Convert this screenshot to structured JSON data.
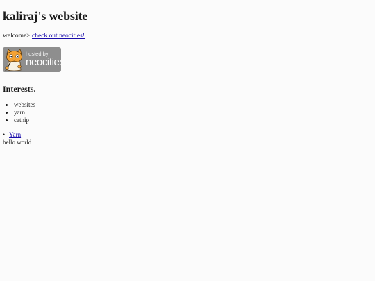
{
  "page": {
    "title": "kaliraj's website",
    "welcome_text": "welcome> ",
    "welcome_link": "check out neocities!"
  },
  "badge": {
    "hosted_by": "hosted by",
    "brand": "neocities",
    "mascot_icon": "neocities-cat-icon",
    "background_color": "#8e8e8e"
  },
  "interests": {
    "heading": "Interests.",
    "items": [
      "websites",
      "yarn",
      "catnip"
    ]
  },
  "yarn_link": "Yarn",
  "footer_text": "hello world",
  "colors": {
    "link": "#1a0dab",
    "background": "#fbfbfb"
  }
}
